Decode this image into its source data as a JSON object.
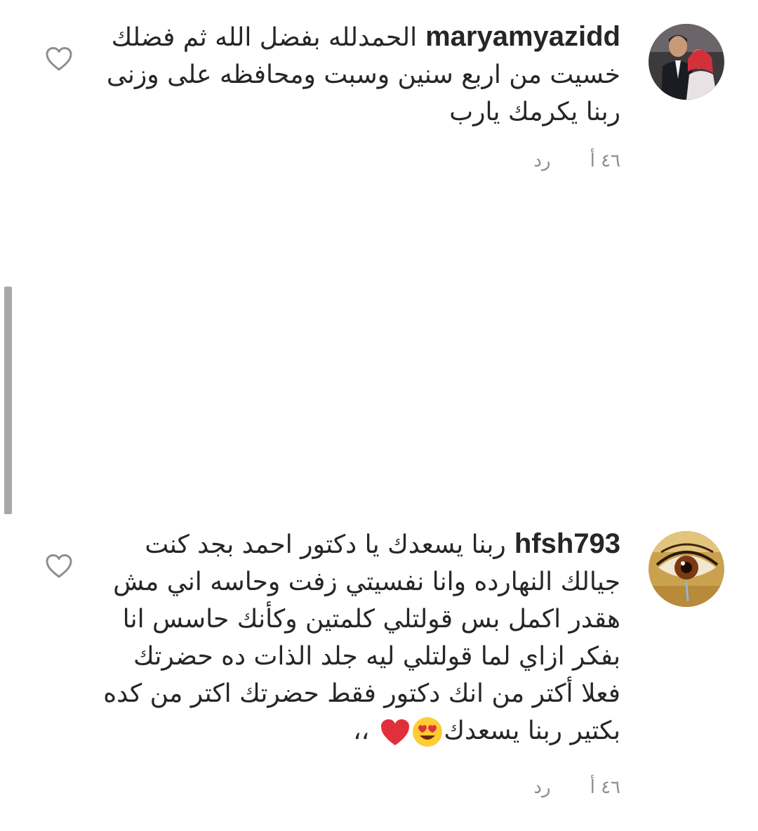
{
  "comments": [
    {
      "username": "maryamyazidd",
      "lines": [
        "الحمدلله بفضل الله ثم فضلك",
        "خسيت من اربع سنين وسبت ومحافظه على وزنى",
        "ربنا يكرمك يارب"
      ],
      "time": "٤٦ أ",
      "reply_label": "رد",
      "avatar_icon": "couple-photo-avatar",
      "like_icon": "heart-outline-icon"
    },
    {
      "username": "hfsh793",
      "lines": [
        "ربنا يسعدك يا دكتور احمد بجد كنت",
        "جيالك النهارده وانا نفسيتي زفت وحاسه اني مش",
        "هقدر اكمل بس قولتلي كلمتين وكأنك حاسس انا",
        "بفكر ازاي لما قولتلي ليه جلد الذات ده حضرتك",
        "فعلا أكتر من انك دكتور فقط حضرتك اكتر من كده",
        "بكتير ربنا يسعدك"
      ],
      "line_suffix": "،،",
      "emojis": [
        "heart-eyes-emoji",
        "red-heart-emoji"
      ],
      "time": "٤٦ أ",
      "reply_label": "رد",
      "avatar_icon": "eye-painting-avatar",
      "like_icon": "heart-outline-icon"
    }
  ],
  "colors": {
    "text": "#262626",
    "meta": "#8e8e8e",
    "scrollbar": "#a9a9a9",
    "heart": "#e0303b",
    "emoji_face": "#ffcc33"
  }
}
